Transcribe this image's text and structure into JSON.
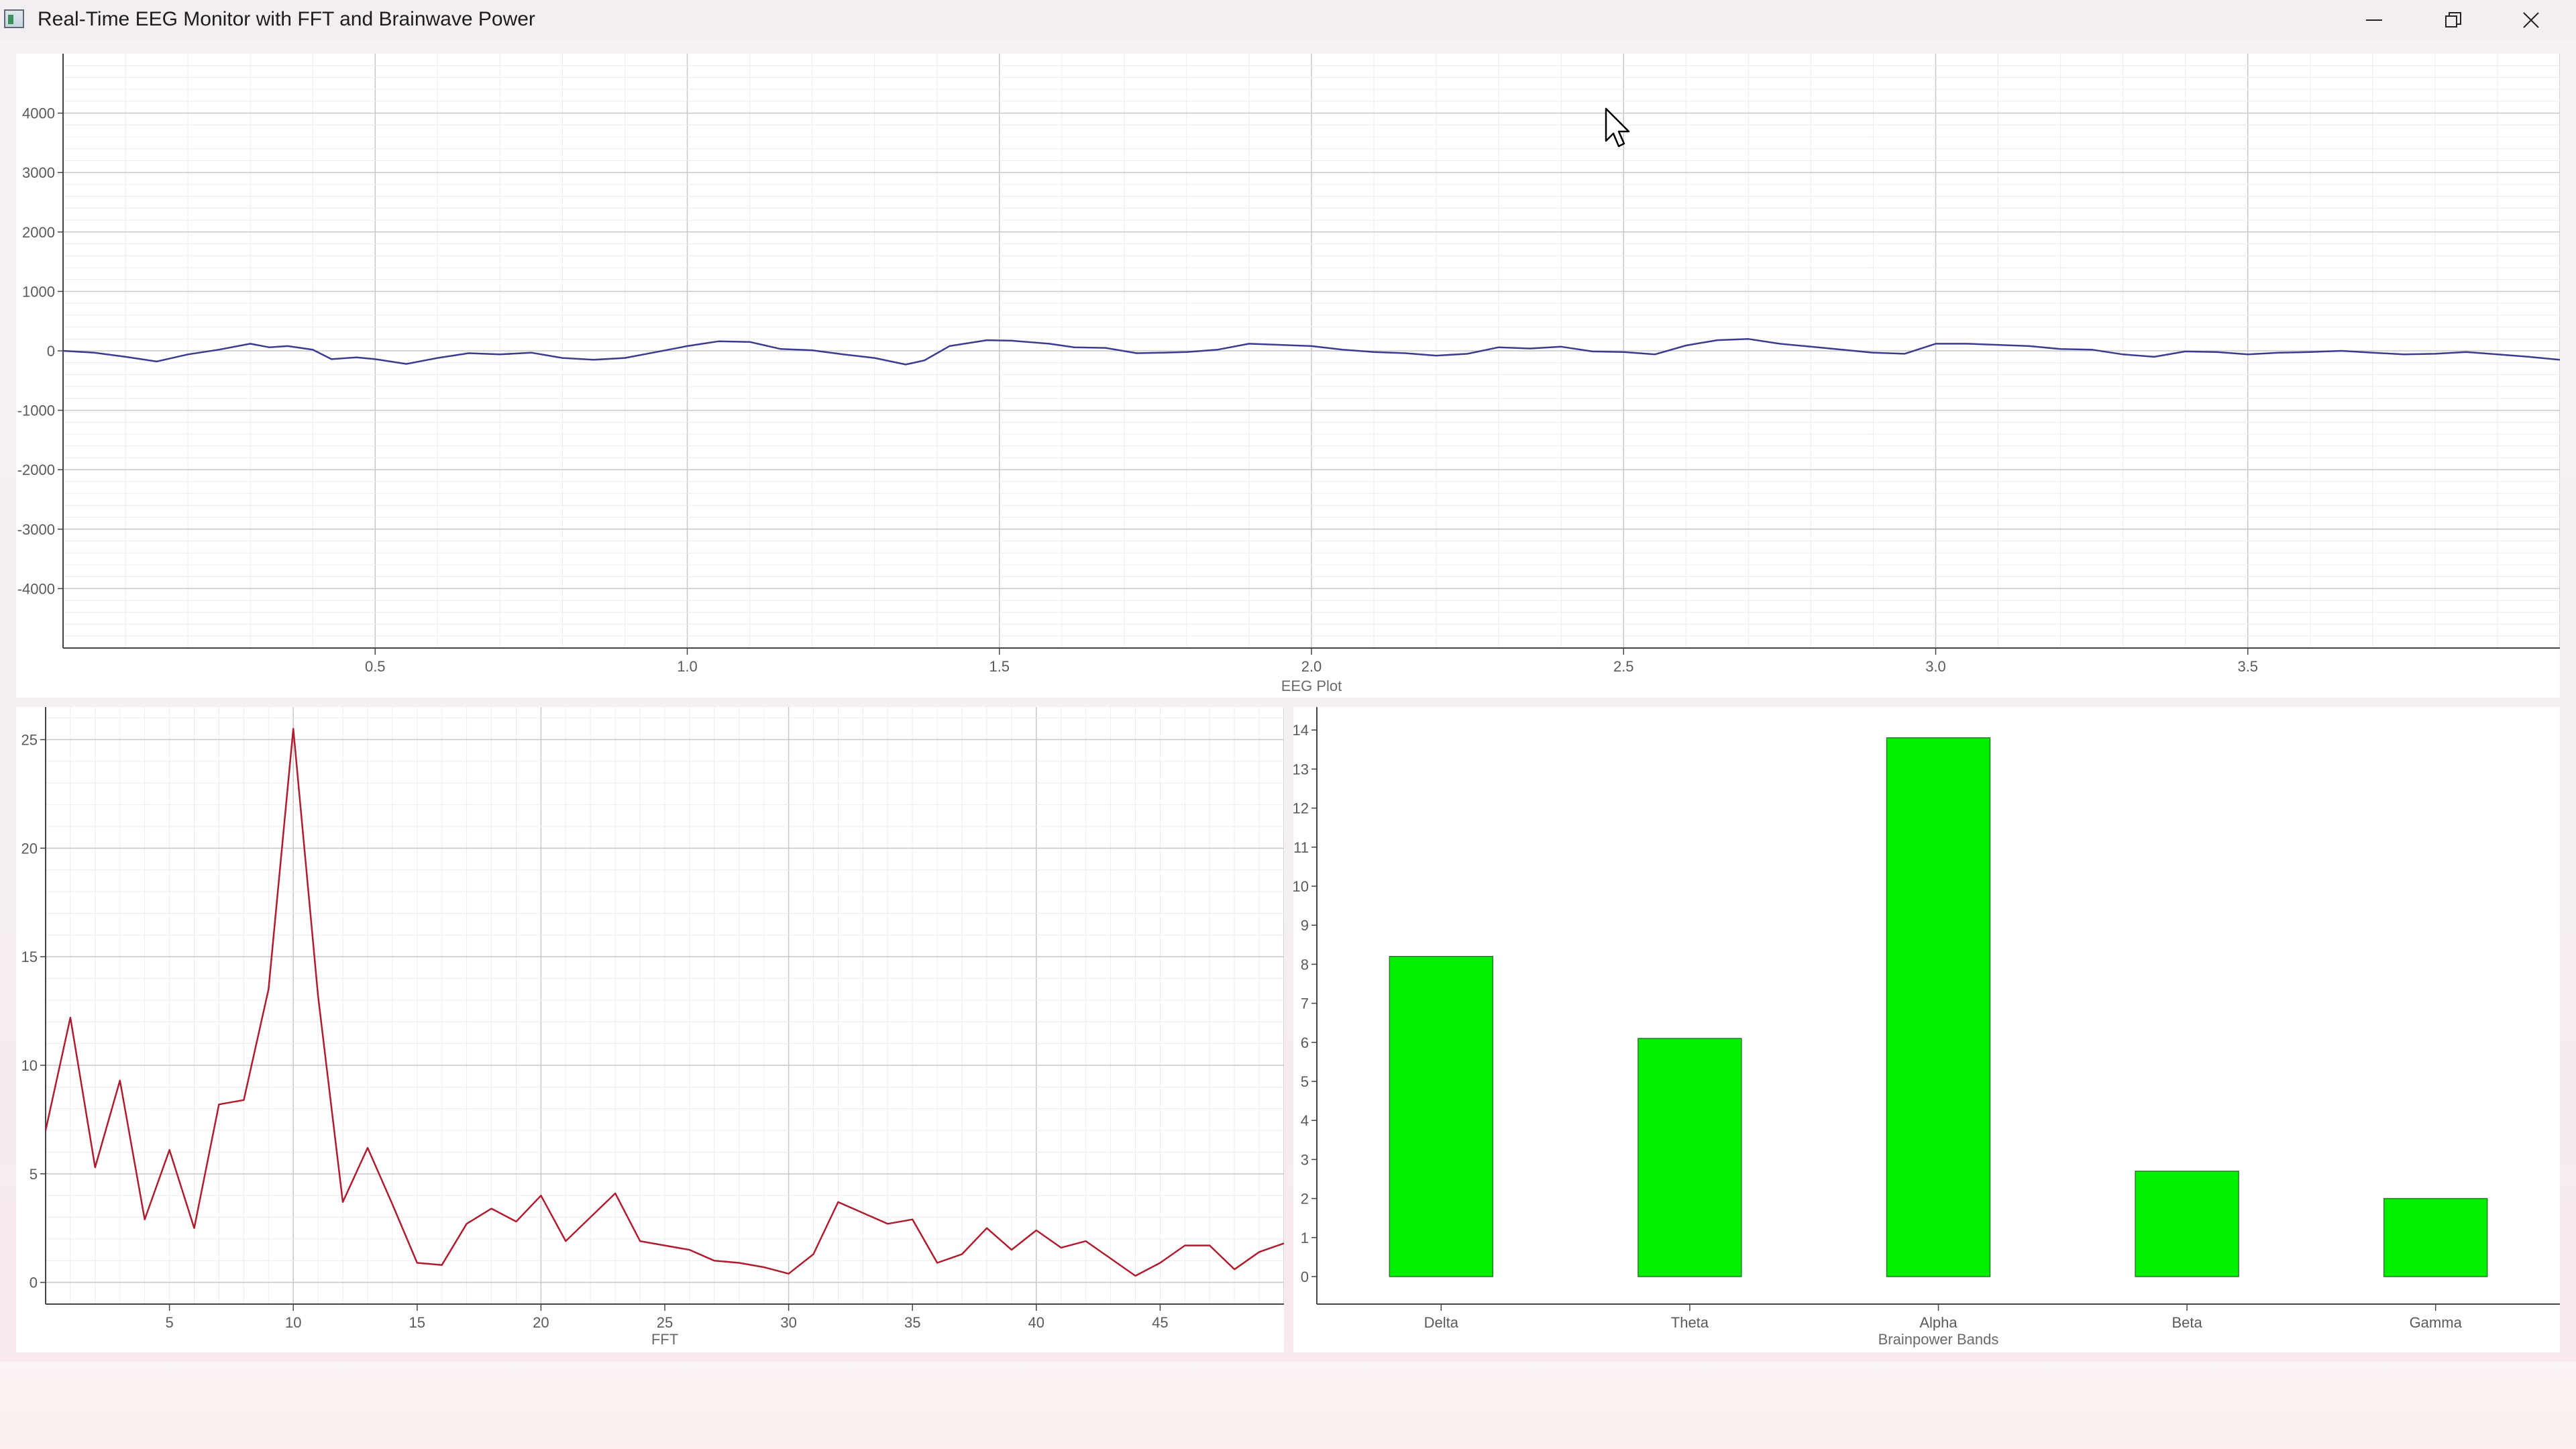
{
  "window": {
    "title": "Real-Time EEG Monitor with FFT and Brainwave Power",
    "icons": {
      "app": "app-icon",
      "minimize": "minimize-icon",
      "maximize": "restore-icon",
      "close": "close-icon"
    }
  },
  "colors": {
    "eeg_line": "#3b3b8f",
    "fft_line": "#b01c2e",
    "bar_fill": "#00f000",
    "grid_major": "#c8c8c8",
    "grid_minor": "#ececec"
  },
  "eeg": {
    "xlabel": "EEG Plot",
    "yticks": [
      "4000",
      "3000",
      "2000",
      "1000",
      "0",
      "-1000",
      "-2000",
      "-3000",
      "-4000"
    ],
    "xticks": [
      "0.5",
      "1.0",
      "1.5",
      "2.0",
      "2.5",
      "3.0",
      "3.5"
    ]
  },
  "fft": {
    "xlabel": "FFT",
    "yticks": [
      "25",
      "20",
      "15",
      "10",
      "5",
      "0"
    ],
    "xticks": [
      "5",
      "10",
      "15",
      "20",
      "25",
      "30",
      "35",
      "40",
      "45"
    ]
  },
  "bands": {
    "xlabel": "Brainpower Bands",
    "yticks": [
      "14",
      "13",
      "12",
      "11",
      "10",
      "9",
      "8",
      "7",
      "6",
      "5",
      "4",
      "3",
      "2",
      "1",
      "0"
    ]
  },
  "chart_data": [
    {
      "type": "line",
      "xlabel": "EEG Plot",
      "ylabel": "",
      "xlim": [
        0,
        4.0
      ],
      "ylim": [
        -5000,
        5000
      ],
      "grid": true,
      "series": [
        {
          "x": [
            0,
            0.05,
            0.1,
            0.15,
            0.2,
            0.25,
            0.3,
            0.33,
            0.36,
            0.4,
            0.43,
            0.47,
            0.5,
            0.55,
            0.6,
            0.65,
            0.7,
            0.75,
            0.8,
            0.85,
            0.9,
            0.95,
            1.0,
            1.05,
            1.1,
            1.15,
            1.2,
            1.25,
            1.3,
            1.35,
            1.38,
            1.42,
            1.48,
            1.52,
            1.58,
            1.62,
            1.67,
            1.72,
            1.76,
            1.8,
            1.85,
            1.9,
            1.95,
            2.0,
            2.05,
            2.1,
            2.15,
            2.2,
            2.25,
            2.3,
            2.35,
            2.4,
            2.45,
            2.5,
            2.55,
            2.6,
            2.65,
            2.7,
            2.75,
            2.8,
            2.85,
            2.9,
            2.95,
            3.0,
            3.05,
            3.1,
            3.15,
            3.2,
            3.25,
            3.3,
            3.35,
            3.4,
            3.45,
            3.5,
            3.55,
            3.6,
            3.65,
            3.7,
            3.75,
            3.8,
            3.85,
            3.9,
            3.95,
            4.0
          ],
          "y": [
            0,
            -30,
            -100,
            -180,
            -60,
            20,
            120,
            60,
            80,
            20,
            -140,
            -110,
            -140,
            -220,
            -120,
            -40,
            -60,
            -30,
            -120,
            -150,
            -120,
            -20,
            80,
            160,
            150,
            30,
            10,
            -60,
            -120,
            -230,
            -160,
            80,
            180,
            170,
            120,
            60,
            50,
            -40,
            -30,
            -20,
            20,
            120,
            100,
            80,
            20,
            -20,
            -40,
            -80,
            -50,
            60,
            40,
            70,
            -10,
            -20,
            -60,
            90,
            180,
            200,
            120,
            70,
            20,
            -30,
            -50,
            120,
            120,
            100,
            80,
            30,
            20,
            -60,
            -100,
            -10,
            -20,
            -60,
            -30,
            -20,
            0,
            -30,
            -60,
            -50,
            -20,
            -60,
            -100,
            -150
          ]
        }
      ]
    },
    {
      "type": "line",
      "xlabel": "FFT",
      "ylabel": "",
      "xlim": [
        0,
        50
      ],
      "ylim": [
        -1,
        26.5
      ],
      "grid": true,
      "series": [
        {
          "x": [
            0,
            1,
            2,
            3,
            4,
            5,
            6,
            7,
            8,
            9,
            10,
            11,
            12,
            13,
            14,
            15,
            16,
            17,
            18,
            19,
            20,
            21,
            22,
            23,
            24,
            25,
            26,
            27,
            28,
            29,
            30,
            31,
            32,
            33,
            34,
            35,
            36,
            37,
            38,
            39,
            40,
            41,
            42,
            43,
            44,
            45,
            46,
            47,
            48,
            49,
            50
          ],
          "y": [
            7.0,
            12.2,
            5.3,
            9.3,
            2.9,
            6.1,
            2.5,
            8.2,
            8.4,
            13.5,
            25.5,
            13.2,
            3.7,
            6.2,
            3.6,
            0.9,
            0.8,
            2.7,
            3.4,
            2.8,
            4.0,
            1.9,
            3.0,
            4.1,
            1.9,
            1.7,
            1.5,
            1.0,
            0.9,
            0.7,
            0.4,
            1.3,
            3.7,
            3.2,
            2.7,
            2.9,
            0.9,
            1.3,
            2.5,
            1.5,
            2.4,
            1.6,
            1.9,
            1.1,
            0.3,
            0.9,
            1.7,
            1.7,
            0.6,
            1.4,
            1.8
          ]
        }
      ]
    },
    {
      "type": "bar",
      "xlabel": "Brainpower Bands",
      "ylabel": "",
      "ylim": [
        -0.7,
        14.3
      ],
      "categories": [
        "Delta",
        "Theta",
        "Alpha",
        "Beta",
        "Gamma"
      ],
      "values": [
        8.2,
        6.1,
        13.8,
        2.7,
        2.0
      ]
    }
  ]
}
